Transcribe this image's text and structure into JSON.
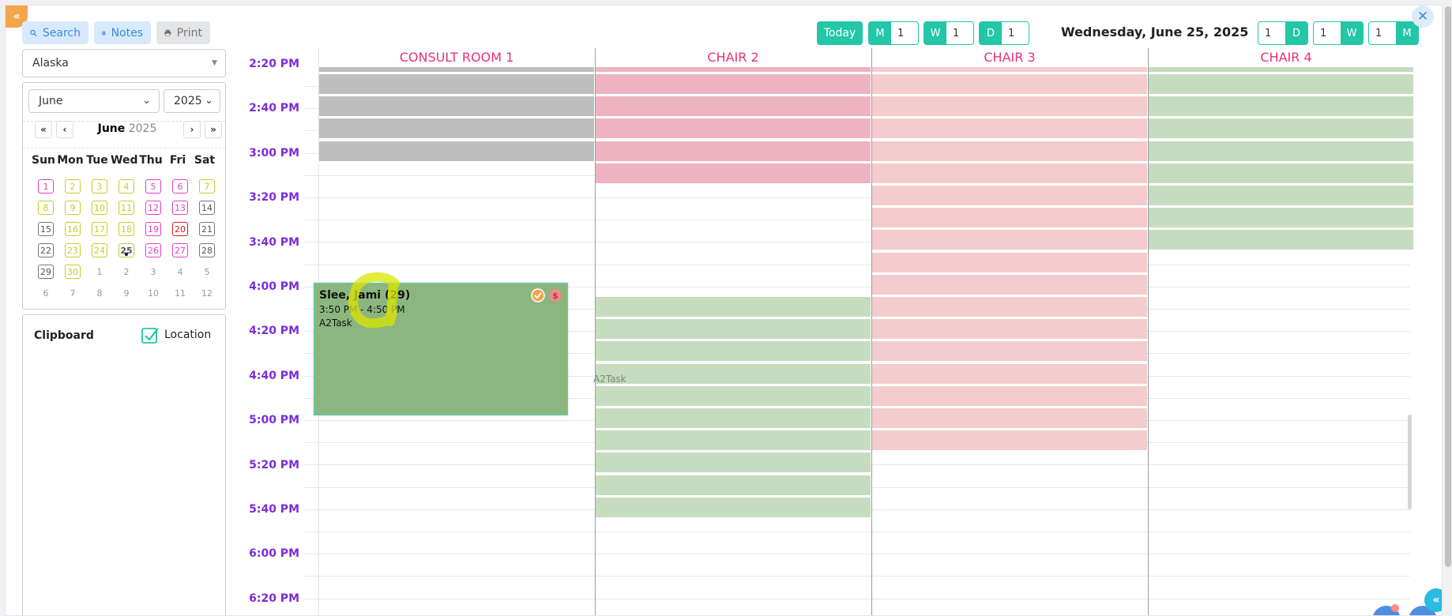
{
  "toolbar": {
    "search_label": "Search",
    "notes_label": "Notes",
    "print_label": "Print",
    "today_label": "Today",
    "month_step": {
      "label": "M",
      "value": "1"
    },
    "week_step": {
      "label": "W",
      "value": "1"
    },
    "day_step": {
      "label": "D",
      "value": "1"
    },
    "date_title": "Wednesday, June 25, 2025",
    "view_day": {
      "label": "D",
      "value": "1"
    },
    "view_week": {
      "label": "W",
      "value": "1"
    },
    "view_month": {
      "label": "M",
      "value": "1"
    }
  },
  "sidebar": {
    "timezone": "Alaska",
    "month_select": "June",
    "year_select": "2025",
    "cal_month": "June",
    "cal_year": "2025",
    "weekdays": [
      "Sun",
      "Mon",
      "Tue",
      "Wed",
      "Thu",
      "Fri",
      "Sat"
    ],
    "weeks": [
      [
        {
          "d": "1",
          "c": "magenta"
        },
        {
          "d": "2",
          "c": "yellow"
        },
        {
          "d": "3",
          "c": "yellow"
        },
        {
          "d": "4",
          "c": "yellow"
        },
        {
          "d": "5",
          "c": "magenta"
        },
        {
          "d": "6",
          "c": "magenta"
        },
        {
          "d": "7",
          "c": "yellow"
        }
      ],
      [
        {
          "d": "8",
          "c": "yellow"
        },
        {
          "d": "9",
          "c": "yellow"
        },
        {
          "d": "10",
          "c": "yellow"
        },
        {
          "d": "11",
          "c": "yellow"
        },
        {
          "d": "12",
          "c": "magenta"
        },
        {
          "d": "13",
          "c": "magenta"
        },
        {
          "d": "14",
          "c": "grey"
        }
      ],
      [
        {
          "d": "15",
          "c": "grey"
        },
        {
          "d": "16",
          "c": "yellow"
        },
        {
          "d": "17",
          "c": "yellow"
        },
        {
          "d": "18",
          "c": "yellow"
        },
        {
          "d": "19",
          "c": "magenta"
        },
        {
          "d": "20",
          "c": "red"
        },
        {
          "d": "21",
          "c": "grey"
        }
      ],
      [
        {
          "d": "22",
          "c": "grey"
        },
        {
          "d": "23",
          "c": "yellow"
        },
        {
          "d": "24",
          "c": "yellow"
        },
        {
          "d": "25",
          "c": "today"
        },
        {
          "d": "26",
          "c": "magenta"
        },
        {
          "d": "27",
          "c": "magenta"
        },
        {
          "d": "28",
          "c": "grey"
        }
      ],
      [
        {
          "d": "29",
          "c": "grey"
        },
        {
          "d": "30",
          "c": "yellow"
        },
        {
          "d": "1",
          "c": "plain"
        },
        {
          "d": "2",
          "c": "plain"
        },
        {
          "d": "3",
          "c": "plain"
        },
        {
          "d": "4",
          "c": "plain"
        },
        {
          "d": "5",
          "c": "plain"
        }
      ],
      [
        {
          "d": "6",
          "c": "plain"
        },
        {
          "d": "7",
          "c": "plain"
        },
        {
          "d": "8",
          "c": "plain"
        },
        {
          "d": "9",
          "c": "plain"
        },
        {
          "d": "10",
          "c": "plain"
        },
        {
          "d": "11",
          "c": "plain"
        },
        {
          "d": "12",
          "c": "plain"
        }
      ]
    ],
    "clipboard_label": "Clipboard",
    "location_label": "Location",
    "location_checked": true
  },
  "calendar": {
    "columns": [
      "CONSULT ROOM 1",
      "CHAIR 2",
      "CHAIR 3",
      "CHAIR 4"
    ],
    "time_labels": [
      "2:20 PM",
      "2:40 PM",
      "3:00 PM",
      "3:20 PM",
      "3:40 PM",
      "4:00 PM",
      "4:20 PM",
      "4:40 PM",
      "5:00 PM",
      "5:20 PM",
      "5:40 PM",
      "6:00 PM",
      "6:20 PM"
    ],
    "appointment": {
      "name": "Slee, Jami (29)",
      "time": "3:50 PM - 4:50 PM",
      "task": "A2Task"
    },
    "ghost_label": "A2Task"
  },
  "colors": {
    "accent": "#23c6a6",
    "column_header": "#e6317a",
    "time_label": "#7b2ed6",
    "appointment_bg": "#8cb67f"
  }
}
